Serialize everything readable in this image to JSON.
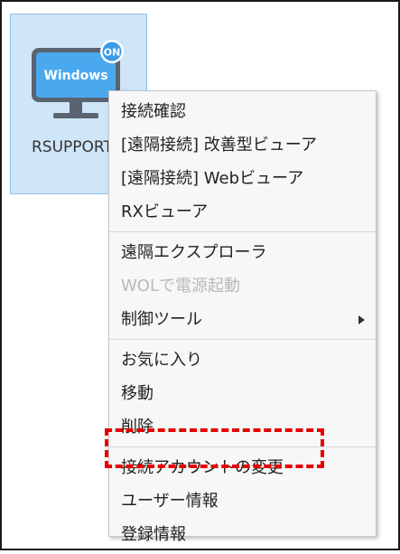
{
  "device": {
    "name": "RSUPPORT",
    "os_label": "Windows",
    "status_badge": "ON",
    "colors": {
      "screen": "#4aa9ee",
      "bezel": "#5a6470",
      "badge": "#3d9be6"
    }
  },
  "menu": {
    "groups": [
      [
        {
          "label": "接続確認",
          "enabled": true
        },
        {
          "label": "[遠隔接続] 改善型ビューア",
          "enabled": true
        },
        {
          "label": "[遠隔接続] Webビューア",
          "enabled": true
        },
        {
          "label": "RXビューア",
          "enabled": true
        }
      ],
      [
        {
          "label": "遠隔エクスプローラ",
          "enabled": true
        },
        {
          "label": "WOLで電源起動",
          "enabled": false
        },
        {
          "label": "制御ツール",
          "enabled": true,
          "submenu": true
        }
      ],
      [
        {
          "label": "お気に入り",
          "enabled": true
        },
        {
          "label": "移動",
          "enabled": true
        },
        {
          "label": "削除",
          "enabled": true
        }
      ],
      [
        {
          "label": "接続アカウントの変更",
          "enabled": true,
          "highlighted": true
        },
        {
          "label": "ユーザー情報",
          "enabled": true
        },
        {
          "label": "登録情報",
          "enabled": true
        }
      ]
    ]
  },
  "highlight_color": "#e60000"
}
